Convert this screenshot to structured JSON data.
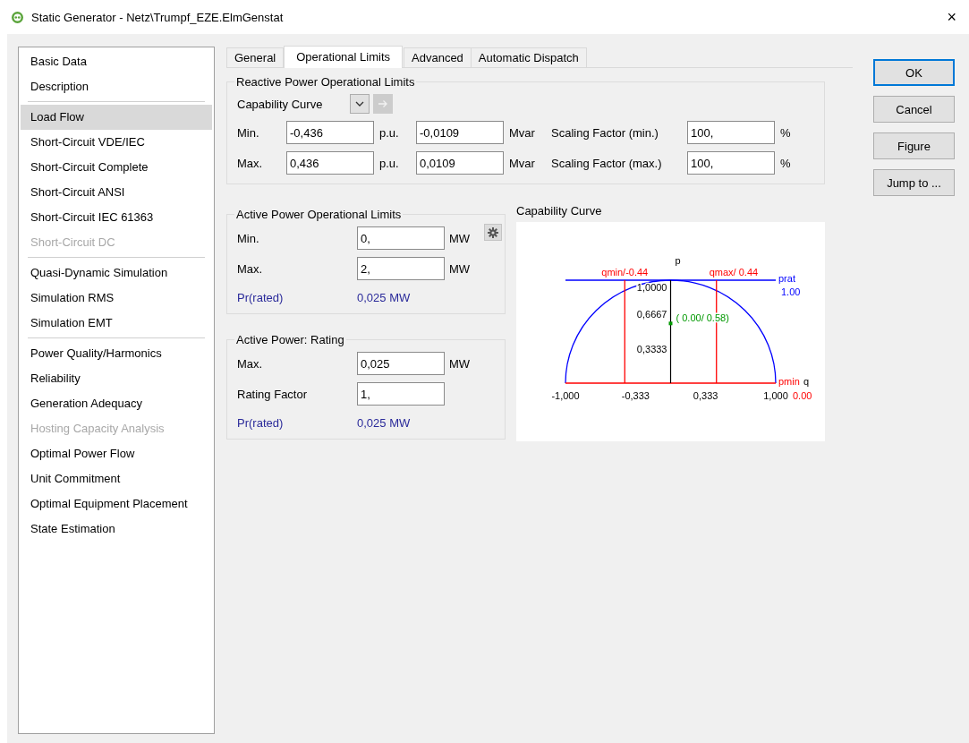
{
  "window": {
    "title": "Static Generator - Netz\\Trumpf_EZE.ElmGenstat",
    "close": "×"
  },
  "sidebar": {
    "groups": [
      [
        {
          "label": "Basic Data",
          "selected": false,
          "disabled": false
        },
        {
          "label": "Description",
          "selected": false,
          "disabled": false
        }
      ],
      [
        {
          "label": "Load Flow",
          "selected": true,
          "disabled": false
        },
        {
          "label": "Short-Circuit VDE/IEC",
          "selected": false,
          "disabled": false
        },
        {
          "label": "Short-Circuit Complete",
          "selected": false,
          "disabled": false
        },
        {
          "label": "Short-Circuit ANSI",
          "selected": false,
          "disabled": false
        },
        {
          "label": "Short-Circuit IEC 61363",
          "selected": false,
          "disabled": false
        },
        {
          "label": "Short-Circuit DC",
          "selected": false,
          "disabled": true
        }
      ],
      [
        {
          "label": "Quasi-Dynamic Simulation",
          "selected": false,
          "disabled": false
        },
        {
          "label": "Simulation RMS",
          "selected": false,
          "disabled": false
        },
        {
          "label": "Simulation EMT",
          "selected": false,
          "disabled": false
        }
      ],
      [
        {
          "label": "Power Quality/Harmonics",
          "selected": false,
          "disabled": false
        },
        {
          "label": "Reliability",
          "selected": false,
          "disabled": false
        },
        {
          "label": "Generation Adequacy",
          "selected": false,
          "disabled": false
        },
        {
          "label": "Hosting Capacity Analysis",
          "selected": false,
          "disabled": true
        },
        {
          "label": "Optimal Power Flow",
          "selected": false,
          "disabled": false
        },
        {
          "label": "Unit Commitment",
          "selected": false,
          "disabled": false
        },
        {
          "label": "Optimal Equipment Placement",
          "selected": false,
          "disabled": false
        },
        {
          "label": "State Estimation",
          "selected": false,
          "disabled": false
        }
      ]
    ]
  },
  "tabs": [
    {
      "label": "General",
      "selected": false
    },
    {
      "label": "Operational Limits",
      "selected": true
    },
    {
      "label": "Advanced",
      "selected": false
    },
    {
      "label": "Automatic Dispatch",
      "selected": false
    }
  ],
  "reactive_limits": {
    "title": "Reactive Power Operational Limits",
    "capability_curve": {
      "label": "Capability Curve",
      "jump_disabled": true
    },
    "rows": [
      [
        {
          "kind": "label",
          "text": "Min."
        },
        {
          "kind": "field",
          "value": "-0,436"
        },
        {
          "kind": "unit",
          "text": "p.u."
        },
        {
          "kind": "field",
          "value": "-0,0109"
        },
        {
          "kind": "unit",
          "text": "Mvar"
        },
        {
          "kind": "label",
          "text": "Scaling Factor (min.)"
        },
        {
          "kind": "field",
          "value": "100,"
        },
        {
          "kind": "unit",
          "text": "%"
        }
      ],
      [
        {
          "kind": "label",
          "text": "Max."
        },
        {
          "kind": "field",
          "value": "0,436"
        },
        {
          "kind": "unit",
          "text": "p.u."
        },
        {
          "kind": "field",
          "value": "0,0109"
        },
        {
          "kind": "unit",
          "text": "Mvar"
        },
        {
          "kind": "label",
          "text": "Scaling Factor (max.)"
        },
        {
          "kind": "field",
          "value": "100,"
        },
        {
          "kind": "unit",
          "text": "%"
        }
      ]
    ]
  },
  "active_limits": {
    "title": "Active Power Operational Limits",
    "rows": [
      [
        {
          "kind": "label",
          "text": "Min."
        },
        {
          "kind": "field",
          "value": "0,"
        },
        {
          "kind": "unit",
          "text": "MW"
        }
      ],
      [
        {
          "kind": "label",
          "text": "Max."
        },
        {
          "kind": "field",
          "value": "2,"
        },
        {
          "kind": "unit",
          "text": "MW"
        }
      ],
      [
        {
          "kind": "info",
          "text": "Pr(rated)"
        },
        {
          "kind": "info",
          "text": "0,025 MW"
        }
      ]
    ]
  },
  "active_rating": {
    "title": "Active Power: Rating",
    "rows": [
      [
        {
          "kind": "label",
          "text": "Max."
        },
        {
          "kind": "field",
          "value": "0,025"
        },
        {
          "kind": "unit",
          "text": "MW"
        }
      ],
      [
        {
          "kind": "label",
          "text": "Rating Factor"
        },
        {
          "kind": "field",
          "value": "1,"
        }
      ],
      [
        {
          "kind": "info",
          "text": "Pr(rated)"
        },
        {
          "kind": "info",
          "text": "0,025 MW"
        }
      ]
    ]
  },
  "capability_chart": {
    "title": "Capability Curve",
    "labels": [
      {
        "kind": "y_title",
        "text": "p"
      },
      {
        "kind": "qmin",
        "text": "qmin/-0.44"
      },
      {
        "kind": "qmax",
        "text": "qmax/ 0.44"
      },
      {
        "kind": "y_tick",
        "text": "1,0000"
      },
      {
        "kind": "prat",
        "text": "prat"
      },
      {
        "kind": "prat_value",
        "text": "1.00"
      },
      {
        "kind": "y_tick",
        "text": "0,6667"
      },
      {
        "kind": "point",
        "text": "( 0.00/ 0.58)"
      },
      {
        "kind": "y_tick",
        "text": "0,3333"
      },
      {
        "kind": "pmin",
        "text": "pmin"
      },
      {
        "kind": "x_title",
        "text": "q"
      },
      {
        "kind": "x_tick",
        "text": "-1,000"
      },
      {
        "kind": "x_tick",
        "text": "-0,333"
      },
      {
        "kind": "x_tick",
        "text": "0,333"
      },
      {
        "kind": "x_tick",
        "text": "1,000"
      },
      {
        "kind": "pmin_value",
        "text": "0.00"
      }
    ]
  },
  "buttons": [
    {
      "label": "OK",
      "default": true
    },
    {
      "label": "Cancel",
      "default": false
    },
    {
      "label": "Figure",
      "default": false
    },
    {
      "label": "Jump to ...",
      "default": false
    }
  ]
}
